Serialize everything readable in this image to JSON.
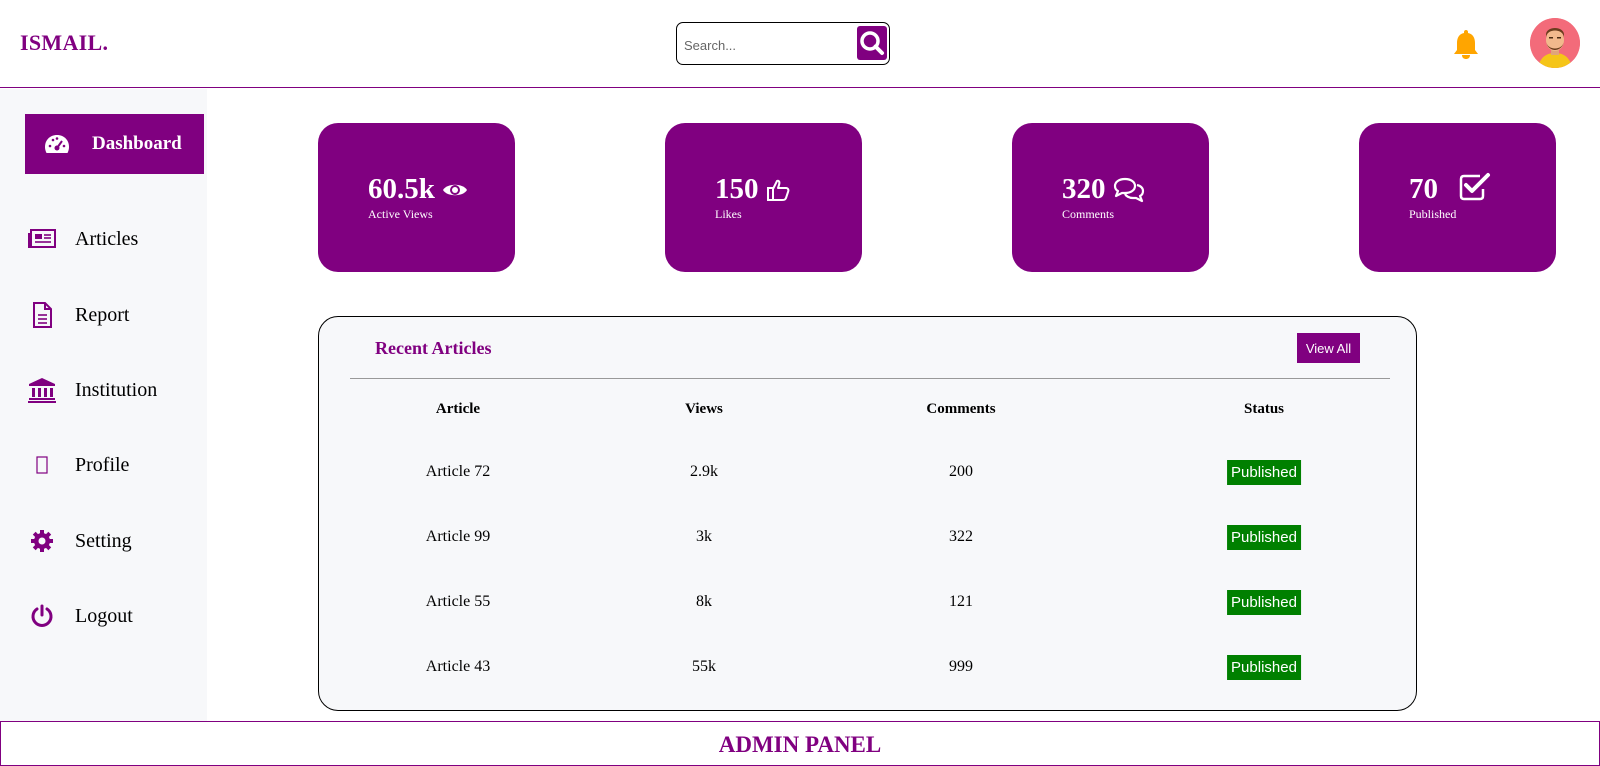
{
  "header": {
    "logo": "ISMAIL.",
    "search_placeholder": "Search...",
    "search_icon": "search-icon",
    "notification_icon": "bell-icon",
    "accent_color": "#800080",
    "bell_color": "#ffa500"
  },
  "sidebar": {
    "items": [
      {
        "label": "Dashboard",
        "icon": "dashboard-icon",
        "active": true
      },
      {
        "label": "Articles",
        "icon": "newspaper-icon"
      },
      {
        "label": "Report",
        "icon": "document-icon"
      },
      {
        "label": "Institution",
        "icon": "bank-icon"
      },
      {
        "label": "Profile",
        "icon": "profile-icon"
      },
      {
        "label": "Setting",
        "icon": "gear-icon"
      },
      {
        "label": "Logout",
        "icon": "power-icon"
      }
    ]
  },
  "stats": [
    {
      "value": "60.5k",
      "label": "Active Views",
      "icon": "eye-icon"
    },
    {
      "value": "150",
      "label": "Likes",
      "icon": "thumbs-up-icon"
    },
    {
      "value": "320",
      "label": "Comments",
      "icon": "comments-icon"
    },
    {
      "value": "70",
      "label": "Published",
      "icon": "check-square-icon"
    }
  ],
  "recent": {
    "title": "Recent Articles",
    "view_all": "View All",
    "columns": [
      "Article",
      "Views",
      "Comments",
      "Status"
    ],
    "rows": [
      {
        "article": "Article 72",
        "views": "2.9k",
        "comments": "200",
        "status": "Published"
      },
      {
        "article": "Article 99",
        "views": "3k",
        "comments": "322",
        "status": "Published"
      },
      {
        "article": "Article 55",
        "views": "8k",
        "comments": "121",
        "status": "Published"
      },
      {
        "article": "Article 43",
        "views": "55k",
        "comments": "999",
        "status": "Published"
      }
    ],
    "status_color": "#008000"
  },
  "footer": {
    "text": "ADMIN PANEL"
  }
}
